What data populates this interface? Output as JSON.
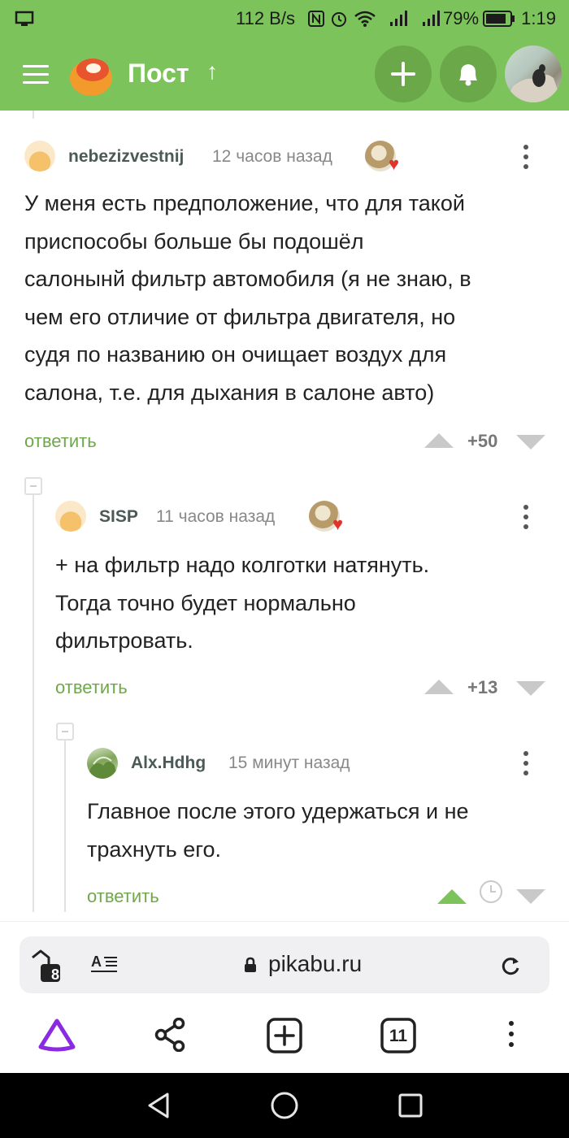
{
  "status_bar": {
    "speed": "112 B/s",
    "battery": "79%",
    "time": "1:19"
  },
  "header": {
    "title": "Пост",
    "up_arrow": "↑",
    "add_icon": "plus-icon",
    "bell_icon": "bell-icon"
  },
  "comments": [
    {
      "username": "nebezizvestnij",
      "time": "12 часов назад",
      "lines": [
        "У меня есть предположение, что для такой",
        "приспособы больше бы подошёл",
        "салонынй фильтр автомобиля (я не знаю, в",
        "чем его отличие от фильтра двигателя, но",
        "судя по названию он очищает воздух для",
        "салона, т.е. для дыхания в салоне авто)"
      ],
      "reply": "ответить",
      "score": "+50"
    },
    {
      "username": "SISP",
      "time": "11 часов назад",
      "lines": [
        "+ на фильтр надо колготки натянуть.",
        "Тогда точно будет нормально",
        "фильтровать."
      ],
      "reply": "ответить",
      "score": "+13"
    },
    {
      "username": "Alx.Hdhg",
      "time": "15 минут назад",
      "lines": [
        "Главное после этого удержаться и не",
        "трахнуть его."
      ],
      "reply": "ответить",
      "score": ""
    }
  ],
  "browser": {
    "tabs_badge": "8",
    "url": "pikabu.ru",
    "tab_count": "11"
  },
  "colors": {
    "brand_green": "#7dc35b",
    "reply_green": "#6fa84a"
  }
}
